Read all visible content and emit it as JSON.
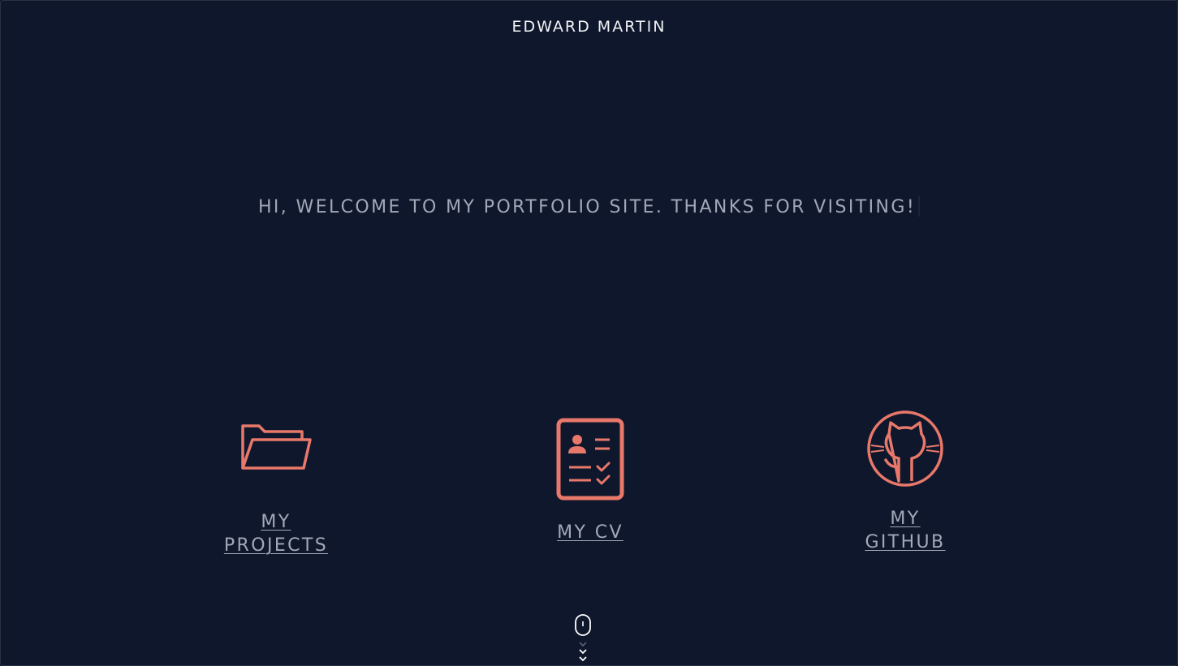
{
  "header": {
    "title": "EDWARD MARTIN"
  },
  "hero": {
    "welcome_text": "HI, WELCOME TO MY PORTFOLIO SITE. THANKS FOR VISITING!"
  },
  "nav_cards": {
    "projects": {
      "label": "MY PROJECTS",
      "line1": "MY",
      "line2": "PROJECTS",
      "icon": "folder-icon"
    },
    "cv": {
      "label": "MY CV",
      "icon": "resume-icon"
    },
    "github": {
      "label": "MY GITHUB",
      "line1": "MY",
      "line2": "GITHUB",
      "icon": "github-icon"
    }
  },
  "scroll_indicator": {
    "icon": "mouse-scroll-icon"
  },
  "colors": {
    "background": "#0f172c",
    "accent": "#e8786a",
    "text_muted": "#a2a8b8",
    "text_bright": "#f2f3f6"
  }
}
